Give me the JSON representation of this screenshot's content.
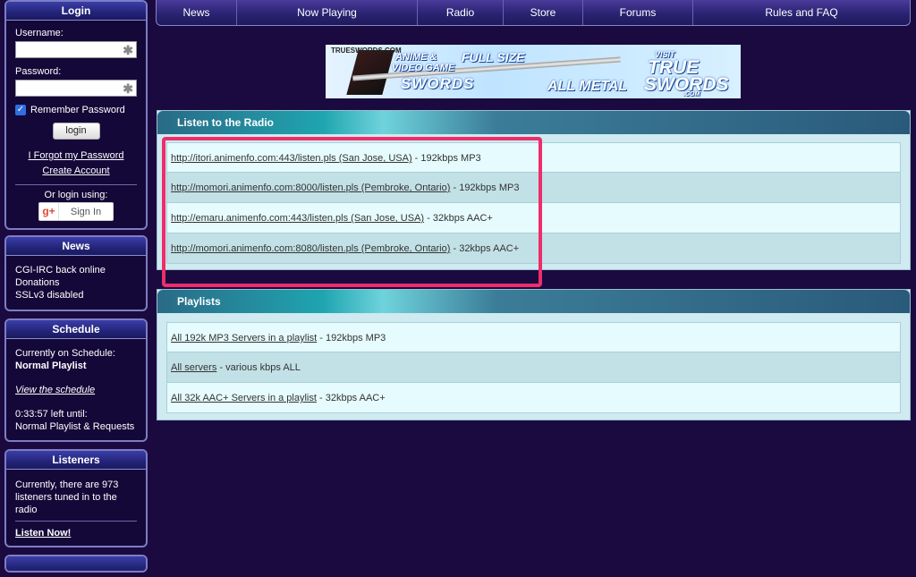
{
  "nav": {
    "items": [
      "News",
      "Now Playing",
      "Radio",
      "Store",
      "Forums",
      "Rules and FAQ"
    ]
  },
  "login": {
    "title": "Login",
    "username_label": "Username:",
    "password_label": "Password:",
    "remember_label": "Remember Password",
    "login_button": "login",
    "forgot_link": "I Forgot my Password",
    "create_link": "Create Account",
    "or_login": "Or login using:",
    "gplus_icon": "g+",
    "sign_in": "Sign In"
  },
  "news": {
    "title": "News",
    "items": [
      "CGI-IRC back online",
      "Donations",
      "SSLv3 disabled"
    ]
  },
  "schedule": {
    "title": "Schedule",
    "current_label": "Currently on Schedule:",
    "current_value": "Normal Playlist",
    "view_link": "View the schedule",
    "time_left": "0:33:57 left until:",
    "next": "Normal Playlist & Requests"
  },
  "listeners": {
    "title": "Listeners",
    "text": "Currently, there are 973 listeners tuned in to the radio",
    "listen_now": "Listen Now!"
  },
  "banner": {
    "site": "TRUESWORDS.COM",
    "anime": "ANIME &",
    "video": "VIDEO GAME",
    "swords": "SWORDS",
    "full_size": "FULL SIZE",
    "all_metal": "ALL METAL",
    "visit": "VISIT",
    "true": "TRUE",
    "swords2": "SWORDS",
    "com": ".COM"
  },
  "radio": {
    "title": "Listen to the Radio",
    "streams": [
      {
        "link": "http://itori.animenfo.com:443/listen.pls (San Jose, USA)",
        "info": " - 192kbps MP3"
      },
      {
        "link": "http://momori.animenfo.com:8000/listen.pls (Pembroke, Ontario)",
        "info": " - 192kbps MP3"
      },
      {
        "link": "http://emaru.animenfo.com:443/listen.pls (San Jose, USA)",
        "info": " - 32kbps AAC+"
      },
      {
        "link": "http://momori.animenfo.com:8080/listen.pls (Pembroke, Ontario)",
        "info": " - 32kbps AAC+"
      }
    ]
  },
  "playlists": {
    "title": "Playlists",
    "items": [
      {
        "link": "All 192k MP3 Servers in a playlist",
        "info": " - 192kbps MP3"
      },
      {
        "link": "All servers",
        "info": " - various kbps ALL"
      },
      {
        "link": "All 32k AAC+ Servers in a playlist",
        "info": " - 32kbps AAC+"
      }
    ]
  },
  "colors": {
    "background": "#1a0a3f",
    "highlight": "#ee2d6a",
    "panel": "#cfeaf0"
  }
}
